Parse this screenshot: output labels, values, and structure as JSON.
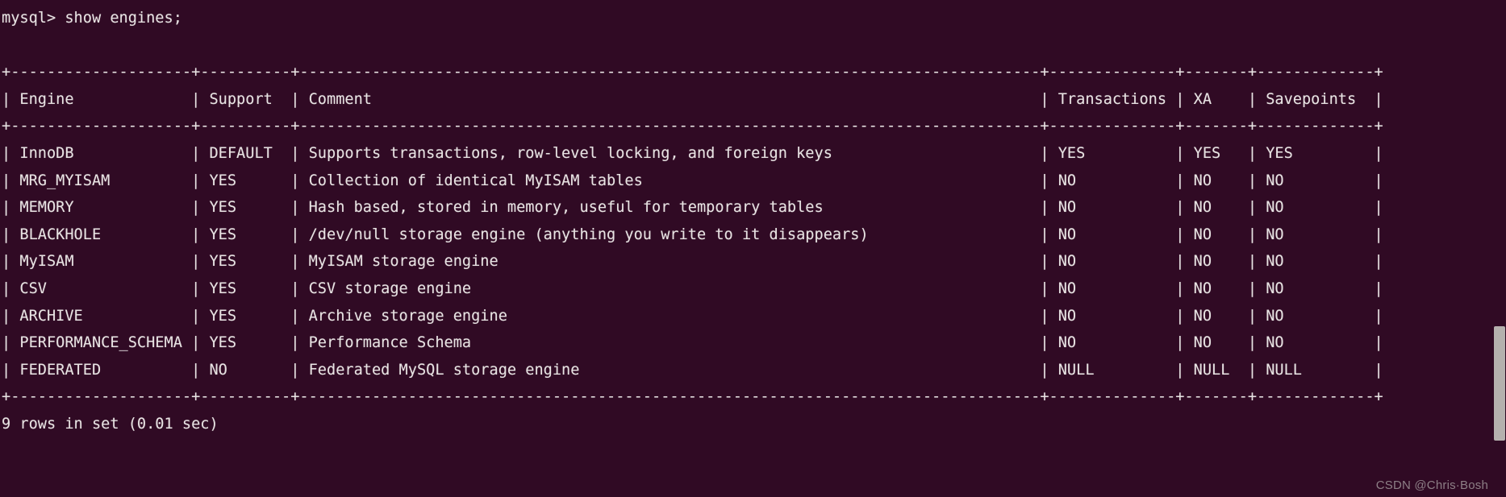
{
  "terminal": {
    "background_color": "#300a24",
    "foreground_color": "#e8e3e3",
    "prompt": "mysql>",
    "command": "show engines;",
    "prompt_line": "mysql> show engines;",
    "status_line": "9 rows in set (0.01 sec)",
    "watermark": "CSDN @Chris·Bosh",
    "scrollbar": {
      "name": "vertical-scrollbar",
      "thumb_color": "#b5b1ae"
    }
  },
  "result_table": {
    "columns": [
      {
        "header": "Engine",
        "width": 18
      },
      {
        "header": "Support",
        "width": 8
      },
      {
        "header": "Comment",
        "width": 80
      },
      {
        "header": "Transactions",
        "width": 12
      },
      {
        "header": "XA",
        "width": 5
      },
      {
        "header": "Savepoints",
        "width": 11
      }
    ],
    "rows": [
      {
        "Engine": "InnoDB",
        "Support": "DEFAULT",
        "Comment": "Supports transactions, row-level locking, and foreign keys",
        "Transactions": "YES",
        "XA": "YES",
        "Savepoints": "YES"
      },
      {
        "Engine": "MRG_MYISAM",
        "Support": "YES",
        "Comment": "Collection of identical MyISAM tables",
        "Transactions": "NO",
        "XA": "NO",
        "Savepoints": "NO"
      },
      {
        "Engine": "MEMORY",
        "Support": "YES",
        "Comment": "Hash based, stored in memory, useful for temporary tables",
        "Transactions": "NO",
        "XA": "NO",
        "Savepoints": "NO"
      },
      {
        "Engine": "BLACKHOLE",
        "Support": "YES",
        "Comment": "/dev/null storage engine (anything you write to it disappears)",
        "Transactions": "NO",
        "XA": "NO",
        "Savepoints": "NO"
      },
      {
        "Engine": "MyISAM",
        "Support": "YES",
        "Comment": "MyISAM storage engine",
        "Transactions": "NO",
        "XA": "NO",
        "Savepoints": "NO"
      },
      {
        "Engine": "CSV",
        "Support": "YES",
        "Comment": "CSV storage engine",
        "Transactions": "NO",
        "XA": "NO",
        "Savepoints": "NO"
      },
      {
        "Engine": "ARCHIVE",
        "Support": "YES",
        "Comment": "Archive storage engine",
        "Transactions": "NO",
        "XA": "NO",
        "Savepoints": "NO"
      },
      {
        "Engine": "PERFORMANCE_SCHEMA",
        "Support": "YES",
        "Comment": "Performance Schema",
        "Transactions": "NO",
        "XA": "NO",
        "Savepoints": "NO"
      },
      {
        "Engine": "FEDERATED",
        "Support": "NO",
        "Comment": "Federated MySQL storage engine",
        "Transactions": "NULL",
        "XA": "NULL",
        "Savepoints": "NULL"
      }
    ]
  }
}
